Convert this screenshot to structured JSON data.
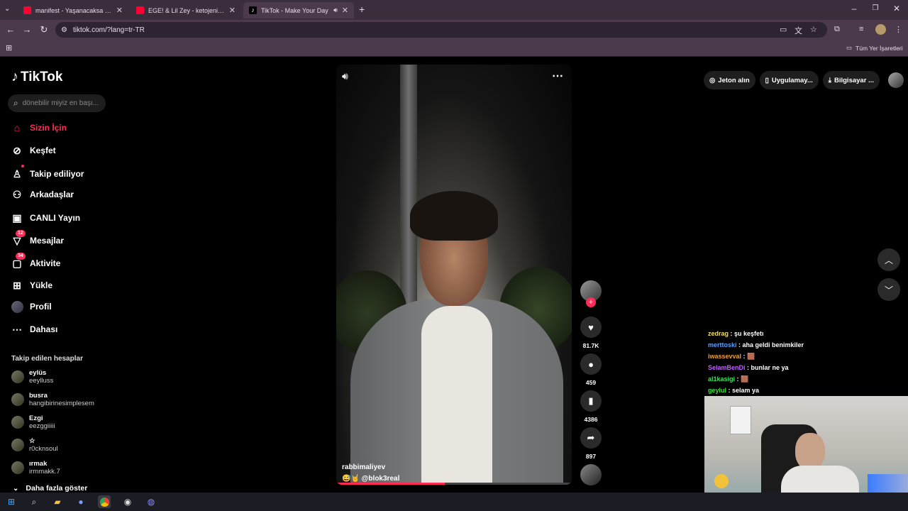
{
  "browser": {
    "tabs": [
      {
        "title": "manifest - Yaşanacaksa | Officia",
        "active": false
      },
      {
        "title": "EGE! & Lil Zey - ketojenik [Offic",
        "active": false
      },
      {
        "title": "TikTok - Make Your Day",
        "active": true
      }
    ],
    "url": "tiktok.com/?lang=tr-TR",
    "bookmarks_all": "Tüm Yer İşaretleri"
  },
  "tiktok": {
    "logo": "TikTok",
    "search_placeholder": "dönebilir miyiz en başı...",
    "nav": [
      {
        "label": "Sizin İçin",
        "icon": "home-icon",
        "active": true
      },
      {
        "label": "Keşfet",
        "icon": "compass-icon"
      },
      {
        "label": "Takip ediliyor",
        "icon": "following-icon"
      },
      {
        "label": "Arkadaşlar",
        "icon": "friends-icon"
      },
      {
        "label": "CANLI Yayın",
        "icon": "live-icon"
      },
      {
        "label": "Mesajlar",
        "icon": "messages-icon",
        "badge": "12"
      },
      {
        "label": "Aktivite",
        "icon": "activity-icon",
        "badge": "34"
      },
      {
        "label": "Yükle",
        "icon": "upload-icon"
      },
      {
        "label": "Profil",
        "icon": "profile-icon"
      },
      {
        "label": "Dahası",
        "icon": "more-icon"
      }
    ],
    "following_header": "Takip edilen hesaplar",
    "following": [
      {
        "name": "eylüs",
        "username": "eeylluss"
      },
      {
        "name": "busra",
        "username": "hangibirinesimplesem"
      },
      {
        "name": "Ezgi",
        "username": "eezggiiiii"
      },
      {
        "name": "☆",
        "username": "r0cknsoul"
      },
      {
        "name": "ırmak",
        "username": "irmmakk.7"
      }
    ],
    "see_more": "Daha fazla göster",
    "top_right": {
      "coins": "Jeton alın",
      "app": "Uygulamay...",
      "desktop": "Bilgisayar ..."
    },
    "video": {
      "author": "rabbimaliyev",
      "caption": "😅🤘 @blok3real",
      "progress": 0.46
    },
    "actions": {
      "likes": "81.7K",
      "comments": "459",
      "saves": "4386",
      "shares": "897"
    }
  },
  "stream_chat": [
    {
      "user": "zedrag",
      "user_color": "#f0e060",
      "msg": "şu keşfetı"
    },
    {
      "user": "merttoski",
      "user_color": "#5aa0ff",
      "msg": "aha geldi benimkiler"
    },
    {
      "user": "iwassevval",
      "user_color": "#f0a030",
      "msg": "🟫"
    },
    {
      "user": "SelamBenDi",
      "user_color": "#c060ff",
      "msg": "bunlar ne ya"
    },
    {
      "user": "al1kasigi",
      "user_color": "#40e060",
      "msg": "🟫"
    },
    {
      "user": "geylul",
      "user_color": "#40e040",
      "msg": "selam ya"
    }
  ]
}
